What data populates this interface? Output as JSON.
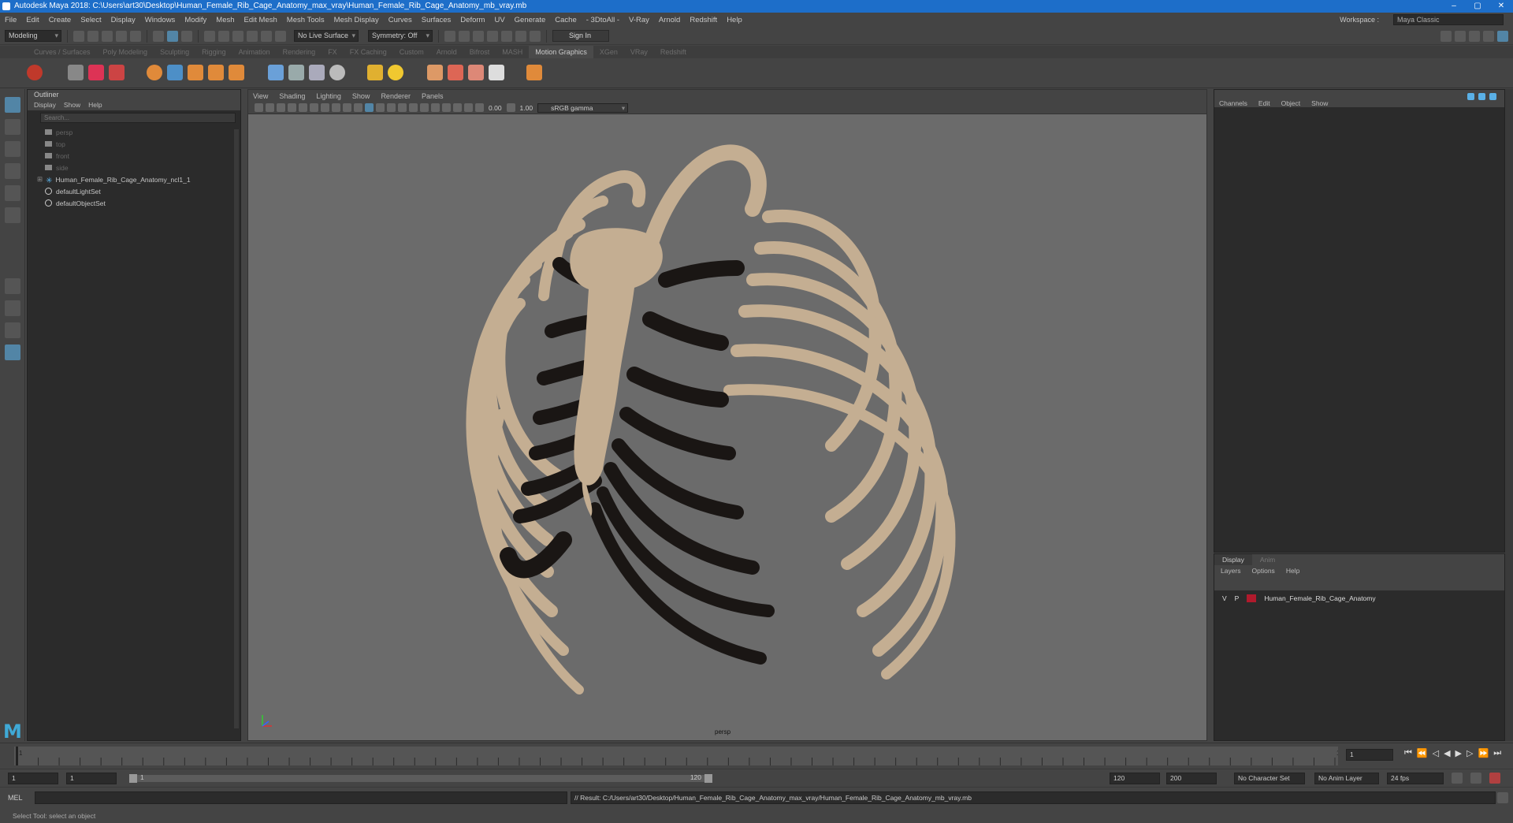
{
  "window": {
    "title": "Autodesk Maya 2018: C:\\Users\\art30\\Desktop\\Human_Female_Rib_Cage_Anatomy_max_vray\\Human_Female_Rib_Cage_Anatomy_mb_vray.mb",
    "controls": [
      "–",
      "▢",
      "✕"
    ]
  },
  "menubar": {
    "items": [
      "File",
      "Edit",
      "Create",
      "Select",
      "Display",
      "Windows",
      "Modify",
      "Mesh",
      "Edit Mesh",
      "Mesh Tools",
      "Mesh Display",
      "Curves",
      "Surfaces",
      "Deform",
      "UV",
      "Generate",
      "Cache",
      "- 3DtoAll -",
      "V-Ray",
      "Arnold",
      "Redshift",
      "Help"
    ],
    "workspace_label": "Workspace :",
    "workspace_value": "Maya Classic"
  },
  "statusline": {
    "mode": "Modeling",
    "live_surface": "No Live Surface",
    "symmetry": "Symmetry: Off",
    "sign_in": "Sign In"
  },
  "shelf": {
    "tabs": [
      "Curves / Surfaces",
      "Poly Modeling",
      "Sculpting",
      "Rigging",
      "Animation",
      "Rendering",
      "FX",
      "FX Caching",
      "Custom",
      "Arnold",
      "Bifrost",
      "MASH",
      "Motion Graphics",
      "XGen",
      "VRay",
      "Redshift"
    ],
    "active_tab": "Motion Graphics"
  },
  "outliner": {
    "title": "Outliner",
    "menu": [
      "Display",
      "Show",
      "Help"
    ],
    "search_placeholder": "Search...",
    "items": [
      {
        "label": "persp",
        "dim": true
      },
      {
        "label": "top",
        "dim": true
      },
      {
        "label": "front",
        "dim": true
      },
      {
        "label": "side",
        "dim": true
      },
      {
        "label": "Human_Female_Rib_Cage_Anatomy_ncl1_1",
        "dim": false
      },
      {
        "label": "defaultLightSet",
        "dim": false
      },
      {
        "label": "defaultObjectSet",
        "dim": false
      }
    ]
  },
  "viewport": {
    "menu": [
      "View",
      "Shading",
      "Lighting",
      "Show",
      "Renderer",
      "Panels"
    ],
    "exposure": "0.00",
    "gamma": "1.00",
    "color_management": "sRGB gamma",
    "camera": "persp"
  },
  "channelbox": {
    "menu": [
      "Channels",
      "Edit",
      "Object",
      "Show"
    ]
  },
  "layers": {
    "tabs": [
      "Display",
      "Anim"
    ],
    "menu": [
      "Layers",
      "Options",
      "Help"
    ],
    "layer": {
      "v": "V",
      "p": "P",
      "name": "Human_Female_Rib_Cage_Anatomy",
      "color": "#b01a2c"
    }
  },
  "timeline": {
    "current_frame": "1",
    "tick_labels": [
      "1",
      "",
      "",
      "",
      "",
      "",
      "",
      "",
      "",
      "",
      "",
      "",
      "",
      "",
      "",
      "",
      "",
      "",
      "",
      "",
      "",
      "",
      "",
      "",
      "",
      "",
      "",
      "",
      "",
      "",
      "",
      "",
      "",
      "",
      "",
      "",
      "",
      "",
      "",
      "",
      "",
      "",
      "",
      "",
      "",
      "",
      "",
      "",
      "",
      "",
      "",
      "",
      "",
      "",
      "",
      "",
      "",
      "",
      "",
      "",
      "",
      "",
      "",
      "120"
    ]
  },
  "range": {
    "start": "1",
    "playback_start": "1",
    "slider_start": "1",
    "slider_end": "120",
    "playback_end": "120",
    "end": "200",
    "character_set": "No Character Set",
    "anim_layer": "No Anim Layer",
    "fps": "24 fps"
  },
  "commandline": {
    "label": "MEL",
    "result": "// Result: C:/Users/art30/Desktop/Human_Female_Rib_Cage_Anatomy_max_vray/Human_Female_Rib_Cage_Anatomy_mb_vray.mb"
  },
  "helpline": {
    "text": "Select Tool: select an object"
  },
  "colors": {
    "bone": "#c4ae92",
    "cartilage": "#1a1614",
    "viewport_bg": "#6b6b6b",
    "accent": "#1d6ec9"
  }
}
